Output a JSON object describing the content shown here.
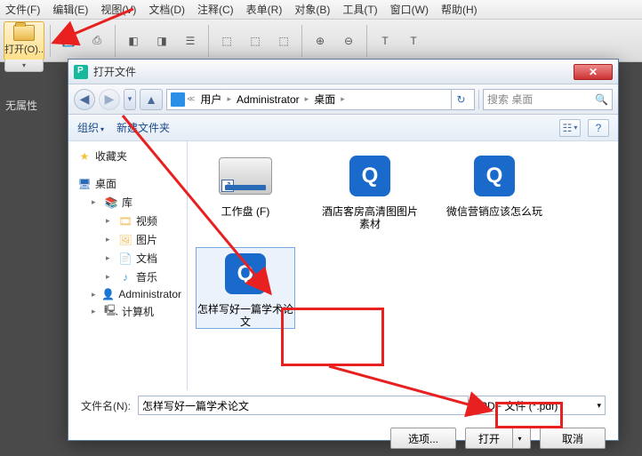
{
  "menu": [
    "文件(F)",
    "编辑(E)",
    "视图(V)",
    "文档(D)",
    "注释(C)",
    "表单(R)",
    "对象(B)",
    "工具(T)",
    "窗口(W)",
    "帮助(H)"
  ],
  "open_btn": "打开(O)..",
  "sidebar_label": "无属性",
  "dialog": {
    "title": "打开文件",
    "breadcrumb": [
      "用户",
      "Administrator",
      "桌面"
    ],
    "search_placeholder": "搜索 桌面",
    "organize": "组织",
    "new_folder": "新建文件夹",
    "tree": {
      "favorites": "收藏夹",
      "desktop": "桌面",
      "libraries": "库",
      "videos": "视频",
      "pictures": "图片",
      "documents": "文档",
      "music": "音乐",
      "admin": "Administrator",
      "computer": "计算机"
    },
    "files": [
      {
        "type": "drive",
        "label": "工作盘 (F)"
      },
      {
        "type": "pdf",
        "label": "酒店客房高清图图片素材"
      },
      {
        "type": "pdf",
        "label": "微信营销应该怎么玩"
      },
      {
        "type": "pdf",
        "label": "怎样写好一篇学术论文",
        "selected": true
      }
    ],
    "filename_label": "文件名(N):",
    "filename_value": "怎样写好一篇学术论文",
    "filter": "PDF 文件 (*.pdf)",
    "options_btn": "选项...",
    "open_btn": "打开",
    "cancel_btn": "取消"
  }
}
